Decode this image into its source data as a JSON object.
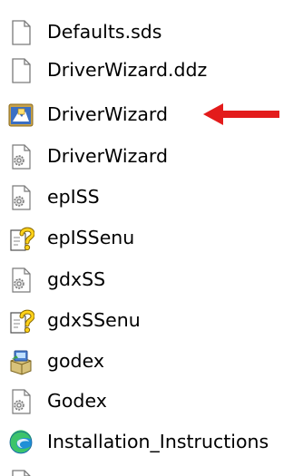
{
  "window": {
    "type": "file-explorer-listing"
  },
  "files": [
    {
      "name": "Defaults.sds",
      "icon": "blank-document-icon"
    },
    {
      "name": "DriverWizard.ddz",
      "icon": "blank-document-icon"
    },
    {
      "name": "DriverWizard",
      "icon": "application-exe-icon"
    },
    {
      "name": "DriverWizard",
      "icon": "settings-file-icon"
    },
    {
      "name": "epISS",
      "icon": "settings-file-icon"
    },
    {
      "name": "epISSenu",
      "icon": "help-file-icon"
    },
    {
      "name": "gdxSS",
      "icon": "settings-file-icon"
    },
    {
      "name": "gdxSSenu",
      "icon": "help-file-icon"
    },
    {
      "name": "godex",
      "icon": "installer-package-icon"
    },
    {
      "name": "Godex",
      "icon": "settings-file-icon"
    },
    {
      "name": "Installation_Instructions",
      "icon": "edge-browser-icon"
    }
  ],
  "annotation": {
    "arrow_color": "#e31b1b",
    "points_to": "DriverWizard"
  },
  "colors": {
    "text": "#000000",
    "background": "#ffffff"
  }
}
